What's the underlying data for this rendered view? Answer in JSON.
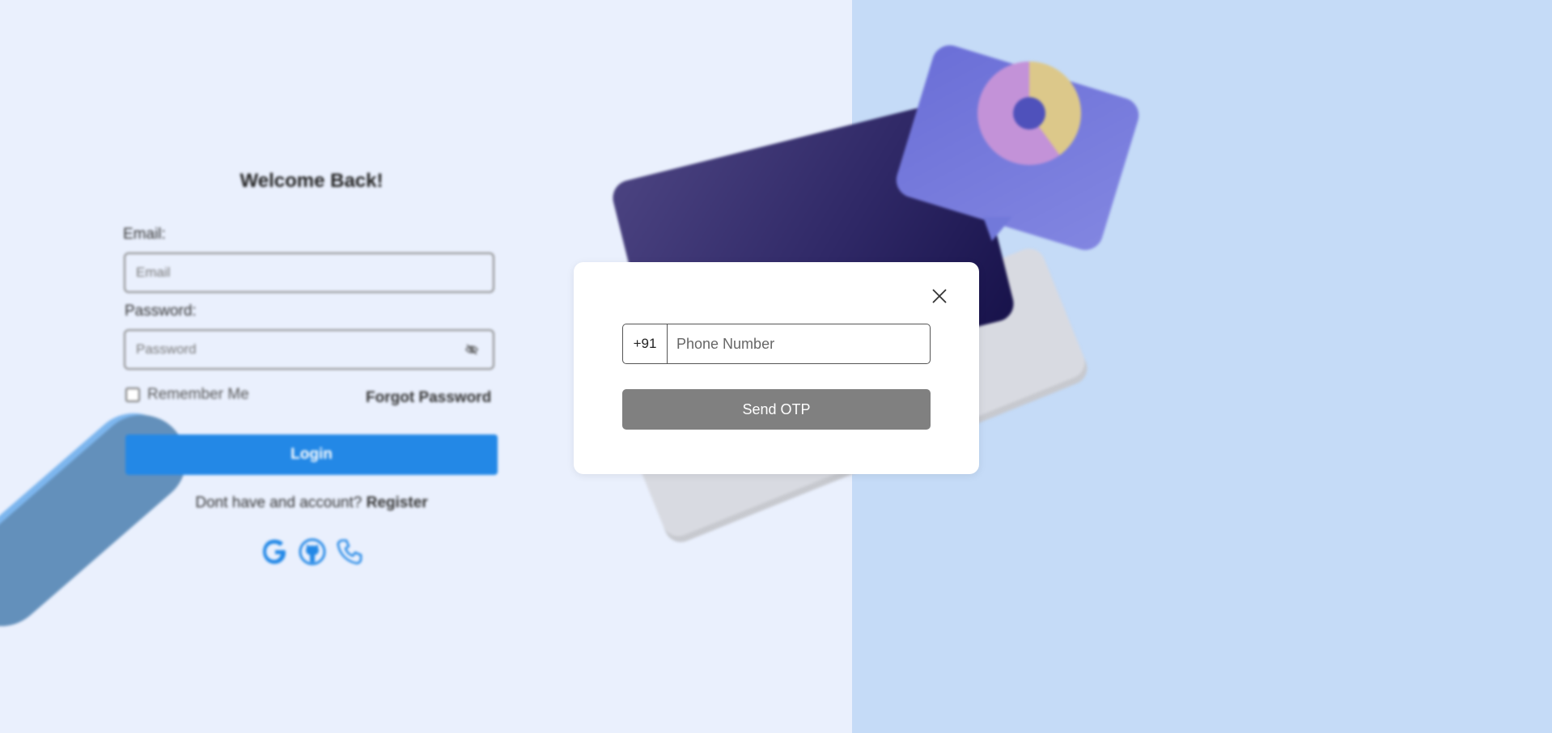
{
  "login": {
    "title": "Welcome Back!",
    "email_label": "Email:",
    "email_placeholder": "Email",
    "password_label": "Password:",
    "password_placeholder": "Password",
    "remember_label": "Remember Me",
    "forgot_label": "Forgot Password",
    "login_button": "Login",
    "register_prompt": "Dont have and account?",
    "register_link": "Register",
    "social_icons": [
      "google-icon",
      "github-icon",
      "phone-icon"
    ]
  },
  "modal": {
    "country_code": "+91",
    "phone_placeholder": "Phone Number",
    "send_button": "Send OTP",
    "close_icon": "close-icon"
  },
  "colors": {
    "primary": "#2388e6",
    "send_button_bg": "#808080",
    "left_bg": "#eaf0fd",
    "right_bg": "#c5dbf7"
  }
}
